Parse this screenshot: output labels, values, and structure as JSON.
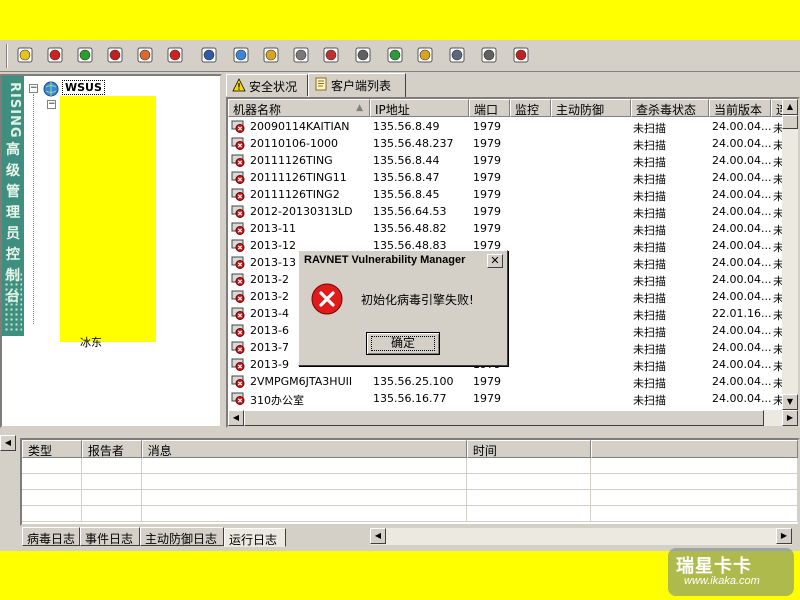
{
  "toolbar": {
    "buttons": [
      "add-client-icon",
      "remove-icon",
      "upload-icon",
      "update-icon",
      "start-scan-icon",
      "stop-scan-icon",
      "monitor-icon",
      "deploy-icon",
      "settings-icon",
      "config-icon",
      "log-icon",
      "print-icon",
      "refresh-icon",
      "find-icon",
      "lock-icon",
      "report-icon",
      "help-icon"
    ]
  },
  "sidebar": {
    "brand_latin": "RISING",
    "brand_cn": [
      "高",
      "级",
      "管",
      "理",
      "员",
      "控",
      "制",
      "台"
    ],
    "tree_root": "WSUS",
    "tree_stub": "冰东"
  },
  "tabs": [
    {
      "label": "安全状况",
      "icon": "warning-icon"
    },
    {
      "label": "客户端列表",
      "icon": "document-icon"
    }
  ],
  "client_list": {
    "columns": [
      "机器名称",
      "IP地址",
      "端口",
      "监控",
      "主动防御",
      "查杀毒状态",
      "当前版本",
      "连"
    ],
    "rows": [
      {
        "name": "20090114KAITIAN",
        "ip": "135.56.8.49",
        "port": "1979",
        "status": "未扫描",
        "version": "24.00.04...",
        "conn": "未"
      },
      {
        "name": "20110106-1000",
        "ip": "135.56.48.237",
        "port": "1979",
        "status": "未扫描",
        "version": "24.00.04...",
        "conn": "未"
      },
      {
        "name": "20111126TING",
        "ip": "135.56.8.44",
        "port": "1979",
        "status": "未扫描",
        "version": "24.00.04...",
        "conn": "未"
      },
      {
        "name": "20111126TING11",
        "ip": "135.56.8.47",
        "port": "1979",
        "status": "未扫描",
        "version": "24.00.04...",
        "conn": "未"
      },
      {
        "name": "20111126TING2",
        "ip": "135.56.8.45",
        "port": "1979",
        "status": "未扫描",
        "version": "24.00.04...",
        "conn": "未"
      },
      {
        "name": "2012-20130313LD",
        "ip": "135.56.64.53",
        "port": "1979",
        "status": "未扫描",
        "version": "24.00.04...",
        "conn": "未"
      },
      {
        "name": "2013-11",
        "ip": "135.56.48.82",
        "port": "1979",
        "status": "未扫描",
        "version": "24.00.04...",
        "conn": "未"
      },
      {
        "name": "2013-12",
        "ip": "135.56.48.83",
        "port": "1979",
        "status": "未扫描",
        "version": "24.00.04...",
        "conn": "未"
      },
      {
        "name": "2013-13",
        "ip": "",
        "port": "",
        "status": "未扫描",
        "version": "24.00.04...",
        "conn": "未"
      },
      {
        "name": "2013-2",
        "ip": "",
        "port": "",
        "status": "未扫描",
        "version": "24.00.04...",
        "conn": "未"
      },
      {
        "name": "2013-2",
        "ip": "",
        "port": "",
        "status": "未扫描",
        "version": "24.00.04...",
        "conn": "未"
      },
      {
        "name": "2013-4",
        "ip": "",
        "port": "",
        "status": "未扫描",
        "version": "22.01.16...",
        "conn": "未"
      },
      {
        "name": "2013-6",
        "ip": "",
        "port": "",
        "status": "未扫描",
        "version": "24.00.04...",
        "conn": "未"
      },
      {
        "name": "2013-7",
        "ip": "",
        "port": "",
        "status": "未扫描",
        "version": "24.00.04...",
        "conn": "未"
      },
      {
        "name": "2013-9",
        "ip": "",
        "port": "1979",
        "status": "未扫描",
        "version": "24.00.04...",
        "conn": "未"
      },
      {
        "name": "2VMPGM6JTA3HUII",
        "ip": "135.56.25.100",
        "port": "1979",
        "status": "未扫描",
        "version": "24.00.04...",
        "conn": "未"
      },
      {
        "name": "310办公室",
        "ip": "135.56.16.77",
        "port": "1979",
        "status": "未扫描",
        "version": "24.00.04...",
        "conn": "未"
      }
    ]
  },
  "log": {
    "columns": [
      "类型",
      "报告者",
      "消息",
      "时间"
    ],
    "tabs": [
      "病毒日志",
      "事件日志",
      "主动防御日志",
      "运行日志"
    ]
  },
  "dialog": {
    "title": "RAVNET Vulnerability Manager",
    "close_label": "✕",
    "message": "初始化病毒引擎失败!",
    "ok_label": "确定"
  },
  "watermark": {
    "cn": "瑞星卡卡",
    "url": "www.ikaka.com"
  }
}
